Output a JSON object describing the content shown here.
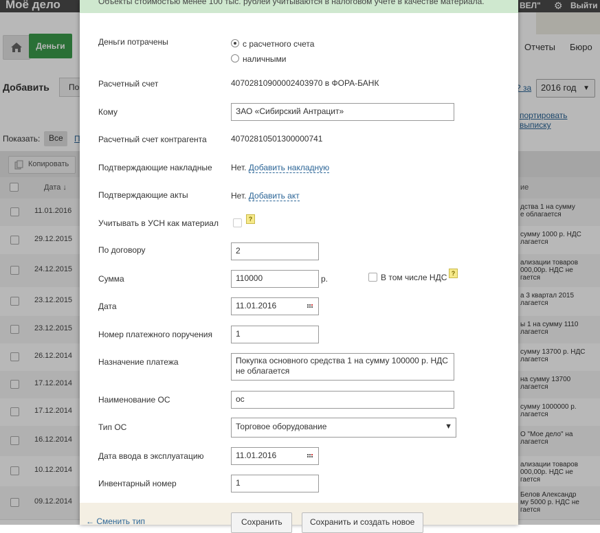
{
  "header": {
    "logo": "Моё дело",
    "org": "ВЕЛ\"",
    "exit": "Выйти"
  },
  "nav": {
    "money": "Деньги",
    "reports": "Отчеты",
    "business": "Бюро"
  },
  "toolbar": {
    "add_label": "Добавить",
    "add_button": "По",
    "period_link": "? за",
    "year": "2016 год",
    "import_link": "портировать выписку",
    "show_label": "Показать:",
    "show_all": "Все",
    "show_partial": "П",
    "copy": "Копировать",
    "col_date": "Дата ↓",
    "col_desc": "ие"
  },
  "rows": [
    {
      "date": "11.01.2016",
      "desc": "дства 1 на сумму\nе облагается"
    },
    {
      "date": "29.12.2015",
      "desc": "сумму 1000 р. НДС\nлагается"
    },
    {
      "date": "24.12.2015",
      "desc": "ализации товаров\n000,00р. НДС не\nгается"
    },
    {
      "date": "23.12.2015",
      "desc": "а 3 квартал 2015\nлагается"
    },
    {
      "date": "23.12.2015",
      "desc": "ы 1 на сумму 1110\nлагается"
    },
    {
      "date": "26.12.2014",
      "desc": "сумму 13700 р. НДС\nлагается"
    },
    {
      "date": "17.12.2014",
      "desc": " на сумму 13700\nлагается"
    },
    {
      "date": "17.12.2014",
      "desc": "сумму 1000000 р.\nлагается"
    },
    {
      "date": "16.12.2014",
      "desc": "О \"Мое дело\" на\nлагается"
    },
    {
      "date": "10.12.2014",
      "desc": "ализации товаров\n000,00р. НДС не\nгается"
    },
    {
      "date": "09.12.2014",
      "desc": "Белов Александр\nму 5000 р. НДС не\nгается"
    }
  ],
  "modal": {
    "notice": "Объекты стоимостью менее 100 тыс. рублей учитываются в налоговом учете в качестве материала.",
    "spent_label": "Деньги потрачены",
    "spent_options": [
      "с расчетного счета",
      "наличными"
    ],
    "account_label": "Расчетный счет",
    "account_value": "40702810900002403970 в ФОРА-БАНК",
    "to_label": "Кому",
    "to_value": "ЗАО «Сибирский Антрацит»",
    "counter_account_label": "Расчетный счет контрагента",
    "counter_account_value": "40702810501300000741",
    "invoices_label": "Подтверждающие накладные",
    "invoices_none": "Нет.",
    "invoices_add": "Добавить накладную",
    "acts_label": "Подтверждающие акты",
    "acts_none": "Нет.",
    "acts_add": "Добавить акт",
    "usn_label": "Учитывать в УСН как материал",
    "contract_label": "По договору",
    "contract_value": "2",
    "sum_label": "Сумма",
    "sum_value": "110000",
    "currency": "р.",
    "vat_label": "В том числе НДС",
    "date_label": "Дата",
    "date_value": "11.01.2016",
    "order_label": "Номер платежного поручения",
    "order_value": "1",
    "purpose_label": "Назначение платежа",
    "purpose_value": "Покупка основного средства 1 на сумму 100000 р. НДС\nне облагается",
    "os_name_label": "Наименование ОС",
    "os_name_value": "ос",
    "os_type_label": "Тип ОС",
    "os_type_value": "Торговое оборудование",
    "commission_label": "Дата ввода в эксплуатацию",
    "commission_value": "11.01.2016",
    "inventory_label": "Инвентарный номер",
    "inventory_value": "1",
    "help": "?",
    "change_type": "← Сменить тип",
    "save": "Сохранить",
    "save_new": "Сохранить и создать новое"
  }
}
